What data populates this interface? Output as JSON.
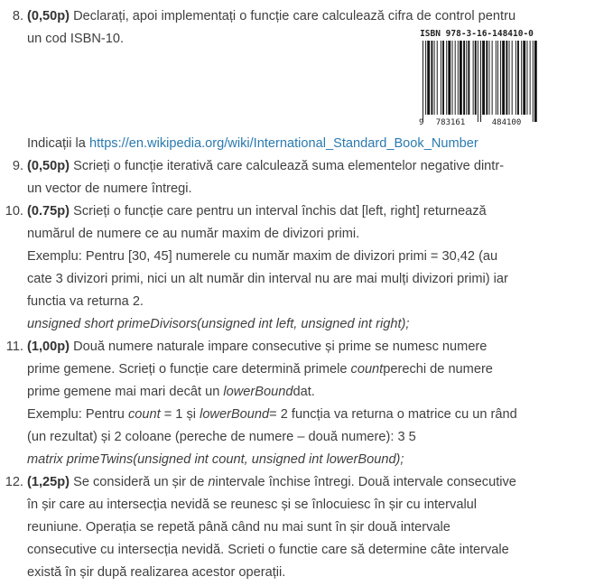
{
  "items": [
    {
      "num": "8.",
      "points": "(0,50p)",
      "line1": "Declarați, apoi implementați o funcție care calculează cifra de control pentru",
      "line2": "un cod ISBN-10.",
      "hint_label": "Indicații la",
      "hint_link": "https://en.wikipedia.org/wiki/International_Standard_Book_Number",
      "barcode": {
        "top_text": "ISBN 978-3-16-148410-0",
        "bottom_left": "9",
        "bottom_mid": "783161",
        "bottom_right": "484100"
      }
    },
    {
      "num": "9.",
      "points": "(0,50p)",
      "line1": "Scrieți o funcție iterativă care calculează suma elementelor negative dintr-",
      "line2": "un vector de numere întregi."
    },
    {
      "num": "10.",
      "points": "(0.75p)",
      "line1": "Scrieți o funcție care pentru un interval închis dat [left, right] returnează",
      "line2": "numărul de numere ce au număr maxim de divizori primi.",
      "line3": "Exemplu: Pentru  [30, 45] numerele cu număr maxim de divizori primi = 30,42 (au",
      "line4": "cate 3 divizori primi, nici un alt număr din interval nu are mai mulți   divizori primi) iar",
      "line5": "functia va returna 2.",
      "signature": "unsigned short primeDivisors(unsigned int left, unsigned int right);"
    },
    {
      "num": "11.",
      "points": "(1,00p)",
      "line1": "Două numere naturale impare consecutive și prime se numesc numere",
      "line2": "prime gemene. Scrieți o funcție care determină primele",
      "line2_em": "count",
      "line2_end": "perechi de numere",
      "line3": "prime gemene mai mari decât un",
      "line3_em": "lowerBound",
      "line3_end": "dat.",
      "line4_a": "Exemplu: Pentru",
      "line4_em1": "count",
      "line4_b": "= 1 și",
      "line4_em2": "lowerBound",
      "line4_c": "= 2 funcția va returna o matrice cu un rând",
      "line5": "(un rezultat) și 2 coloane (pereche de numere – două numere): 3 5",
      "signature": "matrix primeTwins(unsigned int count, unsigned int lowerBound);"
    },
    {
      "num": "12.",
      "points": "(1,25p)",
      "line1_a": "Se consideră un șir de",
      "line1_em": "n",
      "line1_b": "intervale închise întregi. Două intervale consecutive",
      "line2": "în șir care au intersecția nevidă se reunesc și se înlocuiesc în șir cu intervalul",
      "line3": "reuniune. Operația se repetă până când nu mai sunt în șir două intervale",
      "line4": "consecutive cu intersecția nevidă. Scrieti o functie care să determine câte intervale",
      "line5": "există în șir după realizarea acestor operații."
    }
  ]
}
